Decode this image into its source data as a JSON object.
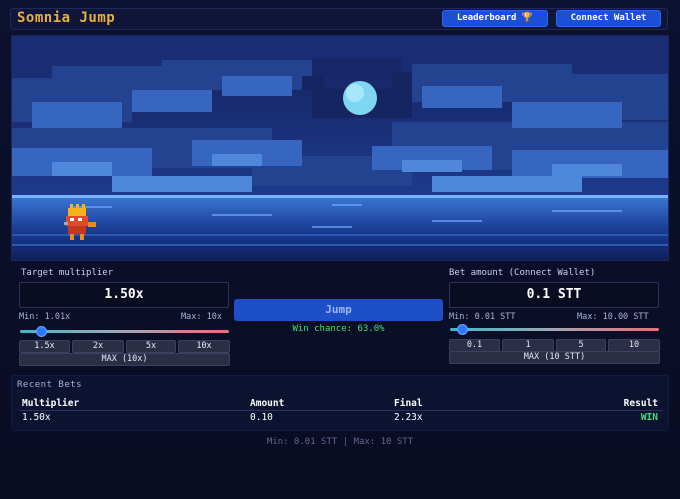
{
  "header": {
    "title": "Somnia Jump",
    "leaderboard_label": "Leaderboard 🏆",
    "connect_label": "Connect Wallet"
  },
  "target": {
    "label": "Target multiplier",
    "value": "1.50x",
    "min_label": "Min: 1.01x",
    "max_label": "Max: 10x",
    "presets": [
      "1.5x",
      "2x",
      "5x",
      "10x"
    ],
    "max_button": "MAX (10x)",
    "slider_fraction": 0.055
  },
  "action": {
    "jump_label": "Jump",
    "win_chance": "Win chance: 63.0%"
  },
  "bet": {
    "label": "Bet amount (Connect Wallet)",
    "value": "0.1 STT",
    "min_label": "Min: 0.01 STT",
    "max_label": "Max: 10.00 STT",
    "presets": [
      "0.1",
      "1",
      "5",
      "10"
    ],
    "max_button": "MAX (10 STT)",
    "slider_fraction": 0.01
  },
  "recent_bets": {
    "title": "Recent Bets",
    "columns": [
      "Multiplier",
      "Amount",
      "Final",
      "Result"
    ],
    "rows": [
      {
        "multiplier": "1.50x",
        "amount": "0.10",
        "final": "2.23x",
        "result": "WIN"
      }
    ]
  },
  "footer": "Min: 0.01 STT | Max: 10 STT",
  "colors": {
    "accent": "#1b4fd6",
    "title": "#e8b13a",
    "win": "#3ee07a",
    "background": "#0a0e27"
  }
}
